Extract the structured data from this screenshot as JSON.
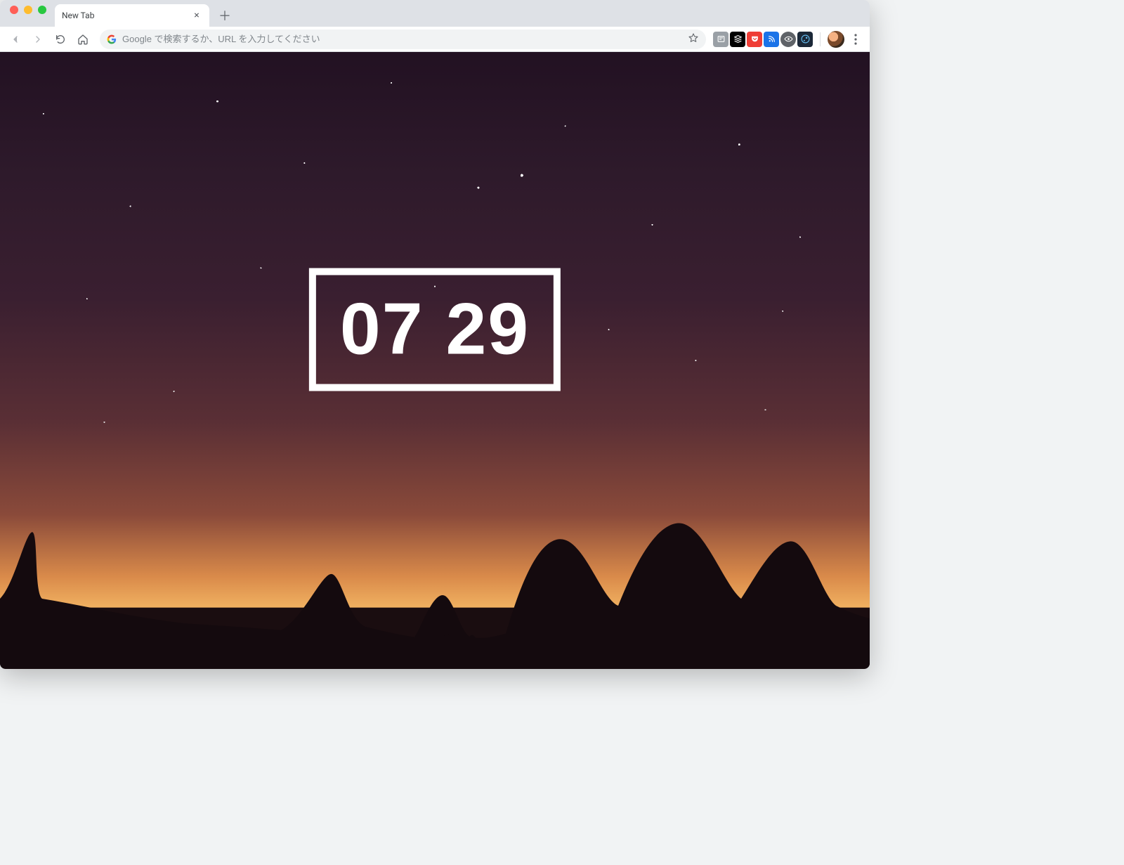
{
  "window": {
    "tab_title": "New Tab"
  },
  "toolbar": {
    "omnibox_placeholder": "Google で検索するか、URL を入力してください",
    "extensions": [
      {
        "name": "newspaper-icon"
      },
      {
        "name": "buffer-icon"
      },
      {
        "name": "pocket-icon"
      },
      {
        "name": "rss-icon"
      },
      {
        "name": "eye-icon"
      },
      {
        "name": "steam-icon"
      }
    ]
  },
  "content": {
    "clock_hours": "07",
    "clock_minutes": "29",
    "accent_color": "#ffffff"
  }
}
